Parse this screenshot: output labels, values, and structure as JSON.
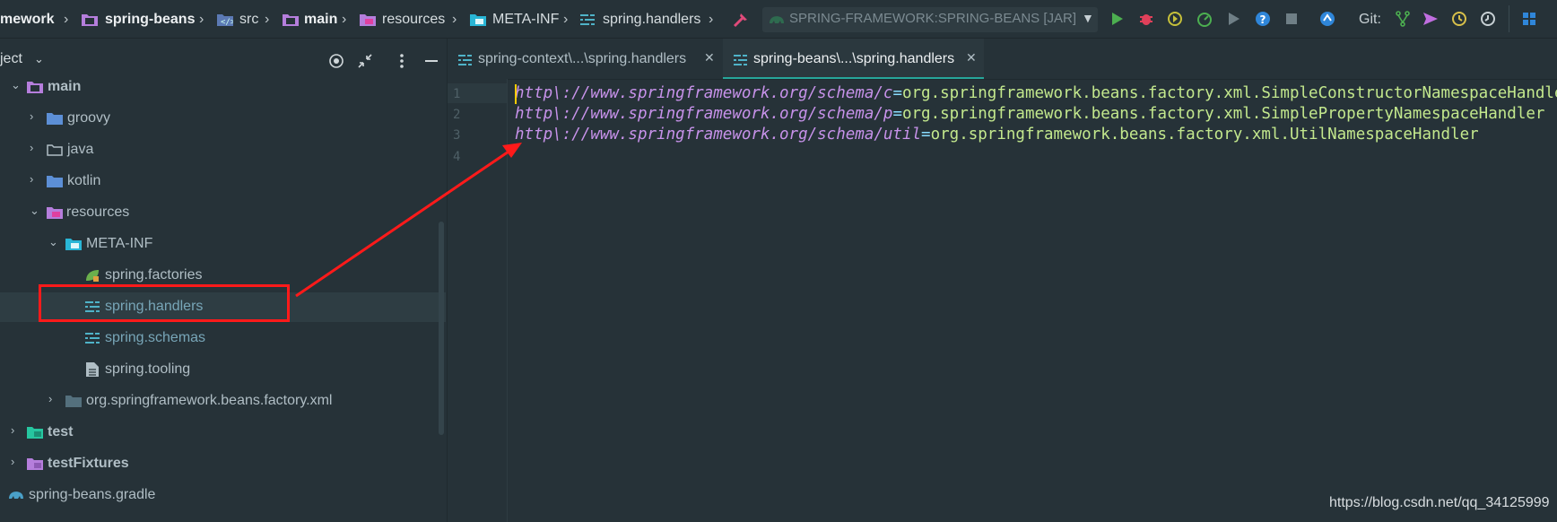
{
  "breadcrumb": [
    {
      "label": "mework",
      "bold": true
    },
    {
      "label": "spring-beans",
      "bold": true
    },
    {
      "label": "src",
      "bold": false
    },
    {
      "label": "main",
      "bold": true
    },
    {
      "label": "resources",
      "bold": false
    },
    {
      "label": "META-INF",
      "bold": false
    },
    {
      "label": "spring.handlers",
      "bold": false
    }
  ],
  "run_config": {
    "label": "SPRING-FRAMEWORK:SPRING-BEANS [JAR]"
  },
  "toolbar": {
    "git_label": "Git:"
  },
  "project_panel": {
    "title": "ject",
    "tree": [
      {
        "label": "main",
        "icon": "module-folder-icon",
        "expanded": true,
        "bold": true
      },
      {
        "label": "groovy",
        "icon": "source-folder-icon",
        "expanded": false
      },
      {
        "label": "java",
        "icon": "folder-icon",
        "expanded": false
      },
      {
        "label": "kotlin",
        "icon": "source-folder-icon",
        "expanded": false
      },
      {
        "label": "resources",
        "icon": "resources-folder-icon",
        "expanded": true
      },
      {
        "label": "META-INF",
        "icon": "meta-folder-icon",
        "expanded": true
      },
      {
        "label": "spring.factories",
        "icon": "spring-icon"
      },
      {
        "label": "spring.handlers",
        "icon": "properties-icon",
        "selected": true
      },
      {
        "label": "spring.schemas",
        "icon": "properties-icon"
      },
      {
        "label": "spring.tooling",
        "icon": "file-icon"
      },
      {
        "label": "org.springframework.beans.factory.xml",
        "icon": "package-folder-icon",
        "expanded": false
      },
      {
        "label": "test",
        "icon": "test-folder-icon",
        "expanded": false,
        "bold": true
      },
      {
        "label": "testFixtures",
        "icon": "fixtures-folder-icon",
        "expanded": false,
        "bold": true
      },
      {
        "label": "spring-beans.gradle",
        "icon": "gradle-icon"
      }
    ]
  },
  "tabs": [
    {
      "label": "spring-context\\...\\spring.handlers",
      "active": false
    },
    {
      "label": "spring-beans\\...\\spring.handlers",
      "active": true
    }
  ],
  "editor": {
    "line_numbers": [
      "1",
      "2",
      "3",
      "4"
    ],
    "lines": [
      {
        "url": "http\\://www.springframework.org/schema/c",
        "eq": "=",
        "value": "org.springframework.beans.factory.xml.SimpleConstructorNamespaceHandler"
      },
      {
        "url": "http\\://www.springframework.org/schema/p",
        "eq": "=",
        "value": "org.springframework.beans.factory.xml.SimplePropertyNamespaceHandler"
      },
      {
        "url": "http\\://www.springframework.org/schema/util",
        "eq": "=",
        "value": "org.springframework.beans.factory.xml.UtilNamespaceHandler"
      }
    ]
  },
  "watermark": "https://blog.csdn.net/qq_34125999",
  "colors": {
    "accent": "#26a69a",
    "annotation": "#ff1a1a",
    "background": "#263238"
  }
}
